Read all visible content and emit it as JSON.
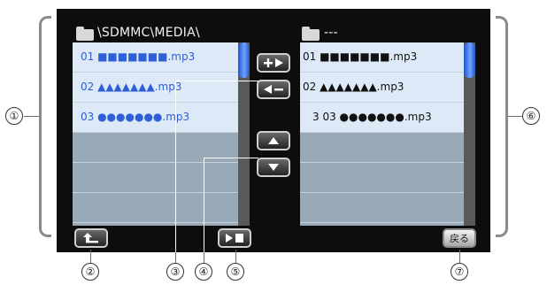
{
  "left_pane": {
    "path": "\\SDMMC\\MEDIA\\",
    "rows": [
      "01 ■■■■■■■.mp3",
      "02 ▲▲▲▲▲▲▲.mp3",
      "03 ●●●●●●●.mp3"
    ]
  },
  "right_pane": {
    "path": "---",
    "rows": [
      "01 ■■■■■■■.mp3",
      "02 ▲▲▲▲▲▲▲.mp3",
      "3 03 ●●●●●●●.mp3"
    ]
  },
  "buttons": {
    "back_label": "戻る"
  },
  "icons": {
    "add": "add-to-playlist-icon",
    "remove": "remove-from-playlist-icon",
    "up": "move-up-icon",
    "down": "move-down-icon",
    "parent": "parent-folder-icon",
    "play_stop": "play-stop-icon",
    "folder": "folder-icon"
  },
  "callouts": [
    "①",
    "②",
    "③",
    "④",
    "⑤",
    "⑥",
    "⑦"
  ]
}
